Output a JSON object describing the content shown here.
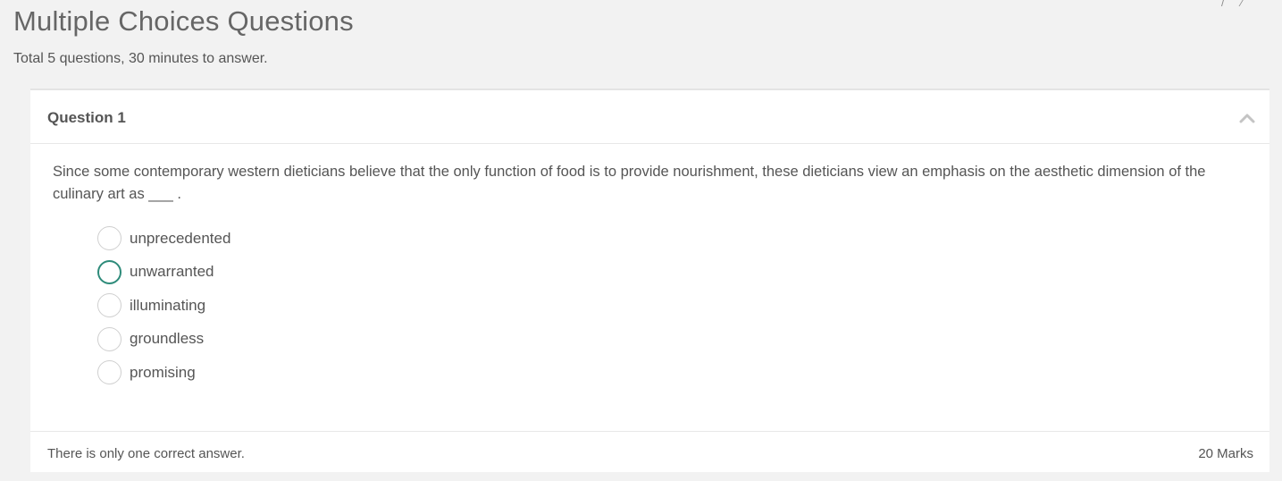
{
  "header": {
    "title": "Multiple Choices Questions",
    "subtitle": "Total 5 questions, 30 minutes to answer."
  },
  "question": {
    "label": "Question 1",
    "collapse_icon": "chevron-up-icon",
    "text": "Since some contemporary western dieticians believe that the only function of food is to provide nourishment, these dieticians view an emphasis on the aesthetic dimension of the culinary art as ___ .",
    "options": [
      {
        "label": "unprecedented",
        "focused": false
      },
      {
        "label": "unwarranted",
        "focused": true
      },
      {
        "label": "illuminating",
        "focused": false
      },
      {
        "label": "groundless",
        "focused": false
      },
      {
        "label": "promising",
        "focused": false
      }
    ],
    "footer_note": "There is only one correct answer.",
    "marks": "20 Marks"
  },
  "colors": {
    "background": "#f2f2f2",
    "card": "#ffffff",
    "radio_focus": "#2e8b7a",
    "radio_border": "#cfcfcf",
    "text": "#555555"
  }
}
